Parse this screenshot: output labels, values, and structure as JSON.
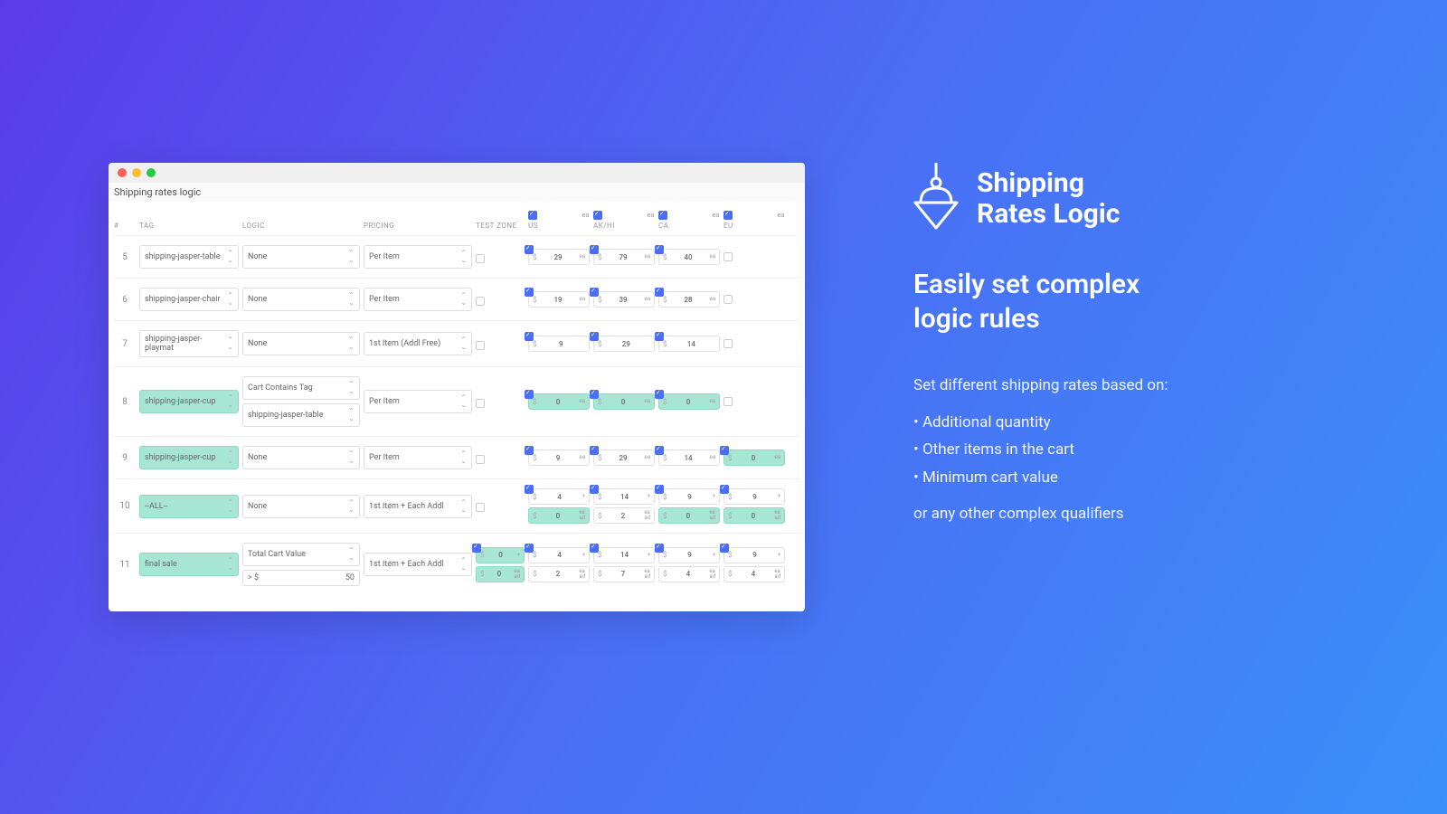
{
  "window": {
    "title": "Shipping rates logic"
  },
  "headers": {
    "num": "#",
    "tag": "TAG",
    "logic": "LOGIC",
    "pricing": "PRICING",
    "testzone": "TEST ZONE",
    "ea": "ea",
    "zones": [
      "US",
      "AK/HI",
      "CA",
      "EU"
    ]
  },
  "rows": [
    {
      "n": "5",
      "tag": "shipping-jasper-table",
      "tagHl": false,
      "logic": [
        {
          "t": "select",
          "v": "None"
        }
      ],
      "pricing": "Per Item",
      "testChecked": false,
      "zones": [
        {
          "chk": true,
          "boxes": [
            {
              "cur": "$",
              "amt": "29",
              "unit": "ea"
            }
          ]
        },
        {
          "chk": true,
          "boxes": [
            {
              "cur": "$",
              "amt": "79",
              "unit": "ea"
            }
          ]
        },
        {
          "chk": true,
          "boxes": [
            {
              "cur": "$",
              "amt": "40",
              "unit": "ea"
            }
          ]
        },
        {
          "chk": false,
          "boxes": []
        }
      ]
    },
    {
      "n": "6",
      "tag": "shipping-jasper-chair",
      "tagHl": false,
      "logic": [
        {
          "t": "select",
          "v": "None"
        }
      ],
      "pricing": "Per Item",
      "testChecked": false,
      "zones": [
        {
          "chk": true,
          "boxes": [
            {
              "cur": "$",
              "amt": "19",
              "unit": "ea"
            }
          ]
        },
        {
          "chk": true,
          "boxes": [
            {
              "cur": "$",
              "amt": "39",
              "unit": "ea"
            }
          ]
        },
        {
          "chk": true,
          "boxes": [
            {
              "cur": "$",
              "amt": "28",
              "unit": "ea"
            }
          ]
        },
        {
          "chk": false,
          "boxes": []
        }
      ]
    },
    {
      "n": "7",
      "tag": "shipping-jasper-playmat",
      "tagHl": false,
      "logic": [
        {
          "t": "select",
          "v": "None"
        }
      ],
      "pricing": "1st Item (Addl Free)",
      "testChecked": false,
      "zones": [
        {
          "chk": true,
          "boxes": [
            {
              "cur": "$",
              "amt": "9",
              "unit": ""
            }
          ]
        },
        {
          "chk": true,
          "boxes": [
            {
              "cur": "$",
              "amt": "29",
              "unit": ""
            }
          ]
        },
        {
          "chk": true,
          "boxes": [
            {
              "cur": "$",
              "amt": "14",
              "unit": ""
            }
          ]
        },
        {
          "chk": false,
          "boxes": []
        }
      ]
    },
    {
      "n": "8",
      "tag": "shipping-jasper-cup",
      "tagHl": true,
      "logic": [
        {
          "t": "select",
          "v": "Cart Contains Tag"
        },
        {
          "t": "select",
          "v": "shipping-jasper-table"
        }
      ],
      "pricing": "Per Item",
      "testChecked": false,
      "zones": [
        {
          "chk": true,
          "boxes": [
            {
              "cur": "$",
              "amt": "0",
              "unit": "ea",
              "hl": true
            }
          ]
        },
        {
          "chk": true,
          "boxes": [
            {
              "cur": "$",
              "amt": "0",
              "unit": "ea",
              "hl": true
            }
          ]
        },
        {
          "chk": true,
          "boxes": [
            {
              "cur": "$",
              "amt": "0",
              "unit": "ea",
              "hl": true
            }
          ]
        },
        {
          "chk": false,
          "boxes": []
        }
      ]
    },
    {
      "n": "9",
      "tag": "shipping-jasper-cup",
      "tagHl": true,
      "logic": [
        {
          "t": "select",
          "v": "None"
        }
      ],
      "pricing": "Per Item",
      "testChecked": false,
      "zones": [
        {
          "chk": true,
          "boxes": [
            {
              "cur": "$",
              "amt": "9",
              "unit": "ea"
            }
          ]
        },
        {
          "chk": true,
          "boxes": [
            {
              "cur": "$",
              "amt": "29",
              "unit": "ea"
            }
          ]
        },
        {
          "chk": true,
          "boxes": [
            {
              "cur": "$",
              "amt": "14",
              "unit": "ea"
            }
          ]
        },
        {
          "chk": true,
          "boxes": [
            {
              "cur": "$",
              "amt": "0",
              "unit": "ea",
              "hl": true
            }
          ]
        }
      ]
    },
    {
      "n": "10",
      "tag": "--ALL--",
      "tagHl": true,
      "logic": [
        {
          "t": "select",
          "v": "None"
        }
      ],
      "pricing": "1st Item + Each Addl",
      "testChecked": false,
      "zones": [
        {
          "chk": true,
          "boxes": [
            {
              "cur": "$",
              "amt": "4",
              "unit": "+"
            },
            {
              "cur": "$",
              "amt": "0",
              "unit": "ea ad",
              "hl": true
            }
          ]
        },
        {
          "chk": true,
          "boxes": [
            {
              "cur": "$",
              "amt": "14",
              "unit": "+"
            },
            {
              "cur": "$",
              "amt": "2",
              "unit": "ea ad"
            }
          ]
        },
        {
          "chk": true,
          "boxes": [
            {
              "cur": "$",
              "amt": "9",
              "unit": "+"
            },
            {
              "cur": "$",
              "amt": "0",
              "unit": "ea ad",
              "hl": true
            }
          ]
        },
        {
          "chk": true,
          "boxes": [
            {
              "cur": "$",
              "amt": "9",
              "unit": "+"
            },
            {
              "cur": "$",
              "amt": "0",
              "unit": "ea ad",
              "hl": true
            }
          ]
        }
      ]
    },
    {
      "n": "11",
      "tag": "final sale",
      "tagHl": true,
      "logic": [
        {
          "t": "select",
          "v": "Total Cart Value"
        },
        {
          "t": "input",
          "prefix": "> $",
          "v": "50"
        }
      ],
      "pricing": "1st Item + Each Addl",
      "testChecked": true,
      "testZone": {
        "boxes": [
          {
            "cur": "$",
            "amt": "0",
            "unit": "+",
            "hl": true
          },
          {
            "cur": "$",
            "amt": "0",
            "unit": "ea ad",
            "hl": true
          }
        ]
      },
      "zones": [
        {
          "chk": true,
          "boxes": [
            {
              "cur": "$",
              "amt": "4",
              "unit": "+"
            },
            {
              "cur": "$",
              "amt": "2",
              "unit": "ea ad"
            }
          ]
        },
        {
          "chk": true,
          "boxes": [
            {
              "cur": "$",
              "amt": "14",
              "unit": "+"
            },
            {
              "cur": "$",
              "amt": "7",
              "unit": "ea ad"
            }
          ]
        },
        {
          "chk": true,
          "boxes": [
            {
              "cur": "$",
              "amt": "9",
              "unit": "+"
            },
            {
              "cur": "$",
              "amt": "4",
              "unit": "ea ad"
            }
          ]
        },
        {
          "chk": true,
          "boxes": [
            {
              "cur": "$",
              "amt": "9",
              "unit": "+"
            },
            {
              "cur": "$",
              "amt": "4",
              "unit": "ea ad"
            }
          ]
        }
      ]
    }
  ],
  "promo": {
    "titleL1": "Shipping",
    "titleL2": "Rates Logic",
    "subL1": "Easily set complex",
    "subL2": "logic rules",
    "lead": "Set different shipping rates based on:",
    "bullets": [
      "Additional quantity",
      "Other items in the cart",
      "Minimum cart value"
    ],
    "trail": "or any other complex qualifiers"
  }
}
